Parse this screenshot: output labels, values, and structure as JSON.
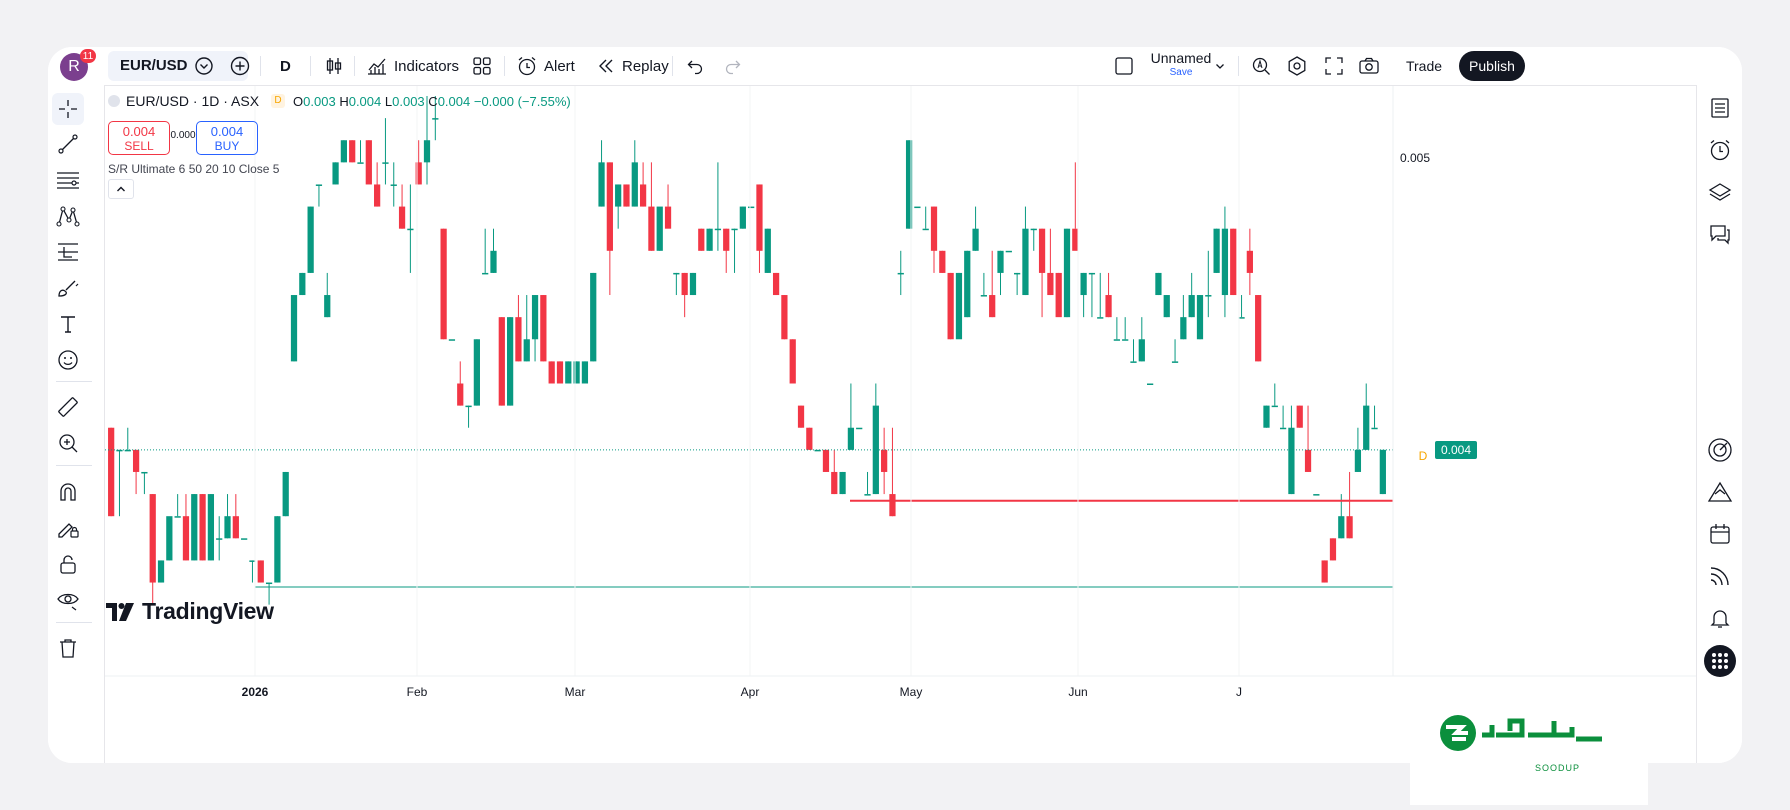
{
  "header": {
    "avatar_letter": "R",
    "notification_count": "11",
    "symbol": "EUR/USD",
    "interval": "D",
    "indicators_label": "Indicators",
    "alert_label": "Alert",
    "replay_label": "Replay",
    "layout_name": "Unnamed",
    "save_label": "Save",
    "trade_label": "Trade",
    "publish_label": "Publish"
  },
  "legend": {
    "title": "EUR/USD · 1D · ASX",
    "source_badge": "D",
    "o_label": "O",
    "o_val": "0.003",
    "h_label": "H",
    "h_val": "0.004",
    "l_label": "L",
    "l_val": "0.003",
    "c_label": "C",
    "c_val": "0.004",
    "change": "−0.000 (−7.55%)",
    "sell_price": "0.004",
    "sell_label": "SELL",
    "spread": "0.000",
    "buy_price": "0.004",
    "buy_label": "BUY",
    "indicator": "S/R Ultimate 6 50 20 10 Close 5"
  },
  "logo_text": "TradingView",
  "watermark_text": "SOODUP",
  "colors": {
    "up": "#089981",
    "down": "#f23645",
    "accent": "#2962ff",
    "publish_bg": "#131722"
  },
  "chart_data": {
    "type": "candlestick",
    "symbol": "EUR/USD",
    "timeframe": "1D",
    "x_tick_labels": [
      "2026",
      "Feb",
      "Mar",
      "Apr",
      "May",
      "Jun",
      "J"
    ],
    "y_tick_labels": [
      "0.005"
    ],
    "last_price_label": "0.004",
    "last_price_marker": "D",
    "support_resistance_lines": [
      {
        "price": 0.00397,
        "color": "#f23645"
      },
      {
        "price": 0.00358,
        "color": "#089981"
      }
    ],
    "candles": [
      [
        0.0043,
        0.0043,
        0.0039,
        0.0039
      ],
      [
        0.0042,
        0.0042,
        0.0039,
        0.0042
      ],
      [
        0.0042,
        0.0043,
        0.0042,
        0.0042
      ],
      [
        0.0042,
        0.0042,
        0.004,
        0.0041
      ],
      [
        0.0041,
        0.0041,
        0.004,
        0.0041
      ],
      [
        0.004,
        0.004,
        0.0035,
        0.0036
      ],
      [
        0.0036,
        0.0037,
        0.0036,
        0.0037
      ],
      [
        0.0037,
        0.0038,
        0.0037,
        0.0039
      ],
      [
        0.0039,
        0.004,
        0.0039,
        0.0039
      ],
      [
        0.0039,
        0.004,
        0.0037,
        0.0037
      ],
      [
        0.0037,
        0.004,
        0.0037,
        0.004
      ],
      [
        0.004,
        0.004,
        0.0037,
        0.0037
      ],
      [
        0.0037,
        0.004,
        0.0037,
        0.004
      ],
      [
        0.0038,
        0.0039,
        0.0037,
        0.0038
      ],
      [
        0.0038,
        0.004,
        0.0038,
        0.0039
      ],
      [
        0.0039,
        0.004,
        0.0038,
        0.0038
      ],
      [
        0.0038,
        0.0038,
        0.0038,
        0.0038
      ],
      [
        0.0037,
        0.0037,
        0.0036,
        0.0037
      ],
      [
        0.0037,
        0.0037,
        0.0036,
        0.0036
      ],
      [
        0.0036,
        0.0036,
        0.0035,
        0.0036
      ],
      [
        0.0036,
        0.0039,
        0.0036,
        0.0039
      ],
      [
        0.0039,
        0.0041,
        0.0039,
        0.0041
      ],
      [
        0.0046,
        0.0049,
        0.0046,
        0.0049
      ],
      [
        0.0049,
        0.005,
        0.0049,
        0.005
      ],
      [
        0.005,
        0.0053,
        0.005,
        0.0053
      ],
      [
        0.0054,
        0.0054,
        0.0053,
        0.0054
      ],
      [
        0.0048,
        0.005,
        0.0048,
        0.0049
      ],
      [
        0.0054,
        0.0055,
        0.0054,
        0.0055
      ],
      [
        0.0055,
        0.0056,
        0.0055,
        0.0056
      ],
      [
        0.0056,
        0.0056,
        0.0055,
        0.0055
      ],
      [
        0.0055,
        0.0056,
        0.0055,
        0.0055
      ],
      [
        0.0056,
        0.0056,
        0.0055,
        0.0054
      ],
      [
        0.0054,
        0.0055,
        0.0053,
        0.0053
      ],
      [
        0.0055,
        0.0057,
        0.0054,
        0.0055
      ],
      [
        0.0054,
        0.0055,
        0.0053,
        0.0054
      ],
      [
        0.0053,
        0.0054,
        0.0052,
        0.0052
      ],
      [
        0.0052,
        0.0054,
        0.005,
        0.0052
      ],
      [
        0.0055,
        0.0056,
        0.0054,
        0.0054
      ],
      [
        0.0055,
        0.0058,
        0.0054,
        0.0056
      ],
      [
        0.0057,
        0.0058,
        0.0056,
        0.0057
      ],
      [
        0.0052,
        0.0052,
        0.0047,
        0.0047
      ],
      [
        0.0047,
        0.0047,
        0.0047,
        0.0047
      ],
      [
        0.0045,
        0.0046,
        0.0044,
        0.0044
      ],
      [
        0.0044,
        0.0044,
        0.0043,
        0.0044
      ],
      [
        0.0044,
        0.0047,
        0.0044,
        0.0047
      ],
      [
        0.005,
        0.0052,
        0.005,
        0.005
      ],
      [
        0.005,
        0.0052,
        0.005,
        0.0051
      ],
      [
        0.0048,
        0.0048,
        0.0044,
        0.0044
      ],
      [
        0.0044,
        0.0048,
        0.0044,
        0.0048
      ],
      [
        0.0048,
        0.0049,
        0.0046,
        0.0046
      ],
      [
        0.0046,
        0.0049,
        0.0046,
        0.0047
      ],
      [
        0.0047,
        0.0049,
        0.0046,
        0.0049
      ],
      [
        0.0049,
        0.0049,
        0.0046,
        0.0046
      ],
      [
        0.0046,
        0.0046,
        0.0045,
        0.0045
      ],
      [
        0.0046,
        0.0046,
        0.0045,
        0.0045
      ],
      [
        0.0045,
        0.0046,
        0.0045,
        0.0046
      ],
      [
        0.0045,
        0.0046,
        0.0045,
        0.0046
      ],
      [
        0.0045,
        0.0046,
        0.0045,
        0.0046
      ],
      [
        0.0046,
        0.005,
        0.0046,
        0.005
      ],
      [
        0.0053,
        0.0056,
        0.0053,
        0.0055
      ],
      [
        0.0055,
        0.0055,
        0.0049,
        0.0051
      ],
      [
        0.0053,
        0.0054,
        0.0052,
        0.0054
      ],
      [
        0.0054,
        0.0054,
        0.0053,
        0.0053
      ],
      [
        0.0053,
        0.0056,
        0.0053,
        0.0055
      ],
      [
        0.0054,
        0.0055,
        0.0053,
        0.0053
      ],
      [
        0.0053,
        0.0055,
        0.0051,
        0.0051
      ],
      [
        0.0051,
        0.0052,
        0.0051,
        0.0053
      ],
      [
        0.0053,
        0.0054,
        0.0053,
        0.0052
      ],
      [
        0.005,
        0.005,
        0.0049,
        0.005
      ],
      [
        0.005,
        0.005,
        0.0048,
        0.0049
      ],
      [
        0.0049,
        0.005,
        0.0049,
        0.005
      ],
      [
        0.0052,
        0.0052,
        0.0051,
        0.0051
      ],
      [
        0.0051,
        0.0052,
        0.0051,
        0.0052
      ],
      [
        0.0052,
        0.0055,
        0.0051,
        0.0052
      ],
      [
        0.0052,
        0.0052,
        0.005,
        0.0051
      ],
      [
        0.0052,
        0.0052,
        0.005,
        0.0052
      ],
      [
        0.0052,
        0.0053,
        0.0052,
        0.0053
      ],
      [
        0.0053,
        0.0053,
        0.0053,
        0.0053
      ],
      [
        0.0054,
        0.0054,
        0.005,
        0.0051
      ],
      [
        0.005,
        0.0052,
        0.005,
        0.0052
      ],
      [
        0.005,
        0.005,
        0.0049,
        0.0049
      ],
      [
        0.0049,
        0.0049,
        0.0047,
        0.0047
      ],
      [
        0.0047,
        0.0047,
        0.0045,
        0.0045
      ],
      [
        0.0044,
        0.0044,
        0.0043,
        0.0043
      ],
      [
        0.0043,
        0.0043,
        0.0042,
        0.0042
      ],
      [
        0.0042,
        0.0042,
        0.0042,
        0.0042
      ],
      [
        0.0042,
        0.0042,
        0.0041,
        0.0041
      ],
      [
        0.0041,
        0.0042,
        0.004,
        0.004
      ],
      [
        0.004,
        0.0041,
        0.004,
        0.0041
      ],
      [
        0.0042,
        0.0045,
        0.0042,
        0.0043
      ],
      [
        0.0043,
        0.0043,
        0.0043,
        0.0043
      ],
      [
        0.004,
        0.0041,
        0.004,
        0.004
      ],
      [
        0.004,
        0.0045,
        0.004,
        0.0044
      ],
      [
        0.0042,
        0.0043,
        0.004,
        0.0041
      ],
      [
        0.004,
        0.0043,
        0.0039,
        0.0039
      ],
      [
        0.005,
        0.0051,
        0.0049,
        0.005
      ],
      [
        0.0052,
        0.0056,
        0.0052,
        0.0056
      ],
      [
        0.0053,
        0.0053,
        0.0053,
        0.0053
      ],
      [
        0.0052,
        0.0053,
        0.0052,
        0.0052
      ],
      [
        0.0053,
        0.0053,
        0.005,
        0.0051
      ],
      [
        0.0051,
        0.0051,
        0.005,
        0.005
      ],
      [
        0.005,
        0.005,
        0.0047,
        0.0047
      ],
      [
        0.0047,
        0.005,
        0.0048,
        0.005
      ],
      [
        0.0048,
        0.0051,
        0.0048,
        0.0051
      ],
      [
        0.0051,
        0.0053,
        0.0051,
        0.0052
      ],
      [
        0.0049,
        0.005,
        0.0049,
        0.0049
      ],
      [
        0.0049,
        0.0051,
        0.0048,
        0.0048
      ],
      [
        0.005,
        0.0051,
        0.0049,
        0.0051
      ],
      [
        0.0051,
        0.0051,
        0.0051,
        0.0051
      ],
      [
        0.005,
        0.005,
        0.0049,
        0.005
      ],
      [
        0.0049,
        0.0053,
        0.0049,
        0.0052
      ],
      [
        0.0052,
        0.0052,
        0.0051,
        0.0052
      ],
      [
        0.0052,
        0.0052,
        0.0048,
        0.005
      ],
      [
        0.005,
        0.0052,
        0.0049,
        0.0049
      ],
      [
        0.005,
        0.005,
        0.0049,
        0.0048
      ],
      [
        0.0048,
        0.0052,
        0.0048,
        0.0052
      ],
      [
        0.0052,
        0.0055,
        0.0052,
        0.0051
      ],
      [
        0.0049,
        0.005,
        0.0048,
        0.005
      ],
      [
        0.005,
        0.005,
        0.0048,
        0.005
      ],
      [
        0.0048,
        0.005,
        0.0048,
        0.0048
      ],
      [
        0.0049,
        0.005,
        0.0048,
        0.0048
      ],
      [
        0.0047,
        0.0048,
        0.0047,
        0.0047
      ],
      [
        0.0047,
        0.0048,
        0.0047,
        0.0047
      ],
      [
        0.0046,
        0.0047,
        0.0046,
        0.0046
      ],
      [
        0.0046,
        0.0048,
        0.0046,
        0.0047
      ],
      [
        0.0045,
        0.0045,
        0.0045,
        0.0045
      ],
      [
        0.0049,
        0.005,
        0.0049,
        0.005
      ],
      [
        0.0048,
        0.0049,
        0.0048,
        0.0049
      ],
      [
        0.0046,
        0.0047,
        0.0046,
        0.0046
      ],
      [
        0.0047,
        0.0049,
        0.0047,
        0.0048
      ],
      [
        0.0048,
        0.005,
        0.0048,
        0.0049
      ],
      [
        0.0047,
        0.0049,
        0.0047,
        0.0049
      ],
      [
        0.0049,
        0.0051,
        0.0048,
        0.0049
      ],
      [
        0.005,
        0.0052,
        0.005,
        0.0052
      ],
      [
        0.0049,
        0.0053,
        0.0048,
        0.0052
      ],
      [
        0.0052,
        0.0052,
        0.0049,
        0.0049
      ],
      [
        0.0048,
        0.0049,
        0.0048,
        0.0048
      ],
      [
        0.0051,
        0.0052,
        0.0049,
        0.005
      ],
      [
        0.0049,
        0.0049,
        0.0046,
        0.0046
      ],
      [
        0.0043,
        0.0044,
        0.0043,
        0.0044
      ],
      [
        0.0044,
        0.0045,
        0.0044,
        0.0044
      ],
      [
        0.0043,
        0.0044,
        0.0043,
        0.0043
      ],
      [
        0.004,
        0.0044,
        0.004,
        0.0043
      ],
      [
        0.0044,
        0.0044,
        0.0043,
        0.0043
      ],
      [
        0.0042,
        0.0044,
        0.0041,
        0.0041
      ],
      [
        0.004,
        0.004,
        0.004,
        0.004
      ],
      [
        0.0037,
        0.0037,
        0.0036,
        0.0036
      ],
      [
        0.0038,
        0.0038,
        0.0037,
        0.0037
      ],
      [
        0.0038,
        0.004,
        0.0038,
        0.0039
      ],
      [
        0.0039,
        0.0041,
        0.0038,
        0.0038
      ],
      [
        0.0041,
        0.0043,
        0.0041,
        0.0042
      ],
      [
        0.0042,
        0.0045,
        0.0042,
        0.0044
      ],
      [
        0.0043,
        0.0044,
        0.0043,
        0.0043
      ],
      [
        0.004,
        0.0042,
        0.004,
        0.0042
      ]
    ],
    "ylim": [
      0.0032,
      0.0058
    ],
    "grid": false
  }
}
